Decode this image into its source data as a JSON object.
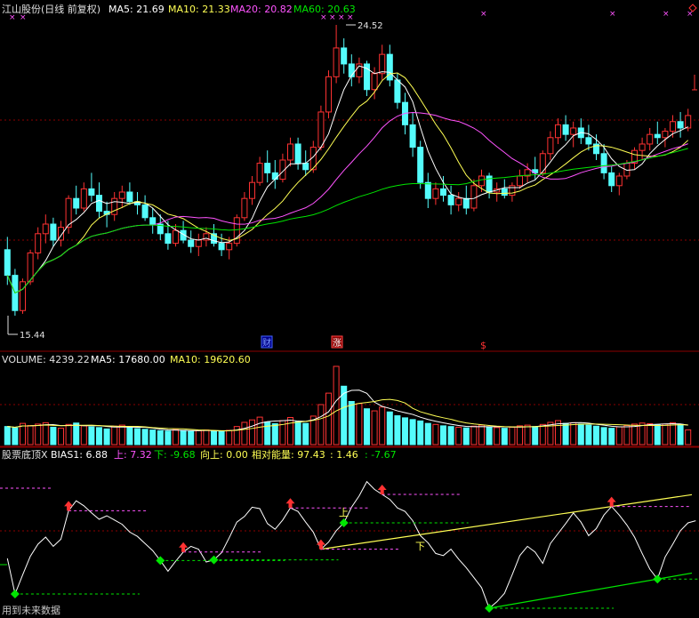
{
  "header": {
    "stock": "江山股份(日线 前复权)",
    "ma5": "MA5: 21.69",
    "ma10": "MA10: 21.33",
    "ma20": "MA20: 20.82",
    "ma60": "MA60: 20.63"
  },
  "volume_header": {
    "title": "VOLUME: 4239.22",
    "ma5": "MA5: 17680.00",
    "ma10": "MA10: 19620.60"
  },
  "indicator_header": {
    "title": "股票底顶X",
    "bias": "BIAS1: 6.88",
    "up": "上: 7.32",
    "down": "下: -9.68",
    "upward": "向上: 0.00",
    "energy": "相对能量: 97.43",
    "v1": ": 1.46",
    "v2": ": -7.67"
  },
  "annotations": {
    "high": "24.52",
    "low": "15.44",
    "event_cai": "财",
    "event_zhang": "涨",
    "event_s": "$",
    "up_mark": "上",
    "down_mark": "下",
    "footer": "用到未来数据"
  },
  "colors": {
    "up": "#ff3232",
    "down": "#54fcfc",
    "ma5": "#ffffff",
    "ma10": "#ffff54",
    "ma20": "#ff54ff",
    "ma60": "#00e600",
    "grid": "#8b0000"
  },
  "chart_data": {
    "type": "candlestick",
    "price_range": [
      15.44,
      24.52
    ],
    "ohlc": [
      [
        17.5,
        17.9,
        16.4,
        16.7
      ],
      [
        16.7,
        16.9,
        15.44,
        15.6
      ],
      [
        15.6,
        16.6,
        15.5,
        16.5
      ],
      [
        16.5,
        17.5,
        16.4,
        17.4
      ],
      [
        17.4,
        18.2,
        17.2,
        18.0
      ],
      [
        18.0,
        18.6,
        17.7,
        18.3
      ],
      [
        18.3,
        18.5,
        17.6,
        17.8
      ],
      [
        17.8,
        18.4,
        17.6,
        18.2
      ],
      [
        18.2,
        19.2,
        18.0,
        19.1
      ],
      [
        19.1,
        19.5,
        18.6,
        18.8
      ],
      [
        18.8,
        19.6,
        18.7,
        19.4
      ],
      [
        19.4,
        19.9,
        19.0,
        19.2
      ],
      [
        19.2,
        19.6,
        18.5,
        18.7
      ],
      [
        18.7,
        19.0,
        18.2,
        18.6
      ],
      [
        18.6,
        19.3,
        18.4,
        19.1
      ],
      [
        19.1,
        19.5,
        18.8,
        19.3
      ],
      [
        19.3,
        19.6,
        18.9,
        19.0
      ],
      [
        19.0,
        19.3,
        18.6,
        18.9
      ],
      [
        18.9,
        19.2,
        18.4,
        18.5
      ],
      [
        18.5,
        18.8,
        18.0,
        18.3
      ],
      [
        18.3,
        18.6,
        17.8,
        18.0
      ],
      [
        18.0,
        18.4,
        17.5,
        17.7
      ],
      [
        17.7,
        18.3,
        17.6,
        18.1
      ],
      [
        18.1,
        18.4,
        17.7,
        17.8
      ],
      [
        17.8,
        18.1,
        17.4,
        17.6
      ],
      [
        17.6,
        18.0,
        17.3,
        17.8
      ],
      [
        17.8,
        18.2,
        17.6,
        18.0
      ],
      [
        18.0,
        18.3,
        17.6,
        17.7
      ],
      [
        17.7,
        18.0,
        17.3,
        17.5
      ],
      [
        17.5,
        17.9,
        17.2,
        17.7
      ],
      [
        17.7,
        18.6,
        17.6,
        18.5
      ],
      [
        18.5,
        19.3,
        18.4,
        19.1
      ],
      [
        19.1,
        19.8,
        18.9,
        19.6
      ],
      [
        19.6,
        20.4,
        19.5,
        20.2
      ],
      [
        20.2,
        20.6,
        19.6,
        19.9
      ],
      [
        19.9,
        20.3,
        19.4,
        19.7
      ],
      [
        19.7,
        20.5,
        19.6,
        20.3
      ],
      [
        20.3,
        21.0,
        20.1,
        20.8
      ],
      [
        20.8,
        21.0,
        20.0,
        20.2
      ],
      [
        20.2,
        20.6,
        19.8,
        20.0
      ],
      [
        20.0,
        20.9,
        19.9,
        20.7
      ],
      [
        20.7,
        22.0,
        20.6,
        21.8
      ],
      [
        21.8,
        23.1,
        21.6,
        22.9
      ],
      [
        22.9,
        24.52,
        22.7,
        23.8
      ],
      [
        23.8,
        24.1,
        23.0,
        23.3
      ],
      [
        23.3,
        23.6,
        22.6,
        22.9
      ],
      [
        22.9,
        23.5,
        22.7,
        23.3
      ],
      [
        23.3,
        23.4,
        22.3,
        22.5
      ],
      [
        22.5,
        23.2,
        22.2,
        23.0
      ],
      [
        23.0,
        23.9,
        22.8,
        23.6
      ],
      [
        23.6,
        23.9,
        22.6,
        22.8
      ],
      [
        22.8,
        23.0,
        21.9,
        22.1
      ],
      [
        22.1,
        22.4,
        21.1,
        21.4
      ],
      [
        21.4,
        21.8,
        20.4,
        20.7
      ],
      [
        20.7,
        20.9,
        19.4,
        19.6
      ],
      [
        19.6,
        19.9,
        18.8,
        19.1
      ],
      [
        19.1,
        19.6,
        18.9,
        19.4
      ],
      [
        19.4,
        19.8,
        19.0,
        19.2
      ],
      [
        19.2,
        19.5,
        18.6,
        18.9
      ],
      [
        18.9,
        19.3,
        18.7,
        19.1
      ],
      [
        19.1,
        19.5,
        18.6,
        18.8
      ],
      [
        18.8,
        19.7,
        18.7,
        19.5
      ],
      [
        19.5,
        20.0,
        19.3,
        19.8
      ],
      [
        19.8,
        19.9,
        19.1,
        19.3
      ],
      [
        19.3,
        19.6,
        19.0,
        19.4
      ],
      [
        19.4,
        19.7,
        19.1,
        19.2
      ],
      [
        19.2,
        19.6,
        19.0,
        19.5
      ],
      [
        19.5,
        20.0,
        19.4,
        19.8
      ],
      [
        19.8,
        20.2,
        19.6,
        20.0
      ],
      [
        20.0,
        20.4,
        19.7,
        19.9
      ],
      [
        19.9,
        20.6,
        19.8,
        20.5
      ],
      [
        20.5,
        21.2,
        20.3,
        21.0
      ],
      [
        21.0,
        21.6,
        20.8,
        21.4
      ],
      [
        21.4,
        21.7,
        20.9,
        21.1
      ],
      [
        21.1,
        21.5,
        20.7,
        21.3
      ],
      [
        21.3,
        21.6,
        20.8,
        21.0
      ],
      [
        21.0,
        21.4,
        20.6,
        20.8
      ],
      [
        20.8,
        21.1,
        20.3,
        20.5
      ],
      [
        20.5,
        20.8,
        19.7,
        19.9
      ],
      [
        19.9,
        20.1,
        19.3,
        19.5
      ],
      [
        19.5,
        19.9,
        19.2,
        19.8
      ],
      [
        19.8,
        20.3,
        19.7,
        20.2
      ],
      [
        20.2,
        20.7,
        20.0,
        20.6
      ],
      [
        20.6,
        21.0,
        20.3,
        20.8
      ],
      [
        20.8,
        21.3,
        20.6,
        21.1
      ],
      [
        21.1,
        21.5,
        20.8,
        21.0
      ],
      [
        21.0,
        21.3,
        20.7,
        21.2
      ],
      [
        21.2,
        21.7,
        21.0,
        21.5
      ],
      [
        21.5,
        21.8,
        21.0,
        21.3
      ],
      [
        21.3,
        21.9,
        21.2,
        21.69
      ]
    ],
    "volume": [
      5200,
      4800,
      6100,
      5500,
      5900,
      6300,
      5000,
      4700,
      5800,
      6200,
      5400,
      5100,
      4900,
      4500,
      5300,
      5600,
      5000,
      4600,
      4400,
      4200,
      4000,
      3900,
      4300,
      4100,
      3800,
      4000,
      4200,
      3900,
      3700,
      4100,
      5200,
      6400,
      7100,
      7900,
      6500,
      6000,
      6900,
      7800,
      6600,
      6100,
      8200,
      11500,
      14800,
      22500,
      16800,
      12400,
      11800,
      10300,
      9700,
      10800,
      9400,
      8300,
      7700,
      7200,
      6800,
      6100,
      5800,
      5400,
      5200,
      5000,
      4800,
      5300,
      5600,
      5100,
      4900,
      4700,
      5000,
      5400,
      5600,
      5200,
      5800,
      6400,
      6900,
      6100,
      6300,
      5900,
      5600,
      5300,
      4900,
      4700,
      5100,
      5500,
      5900,
      6200,
      6000,
      5700,
      5900,
      6300,
      5800,
      4239.22
    ],
    "ma5_close": [
      21.69
    ],
    "indicator": [
      -4.5,
      -9.5,
      -6.8,
      -4.2,
      -2.5,
      -1.5,
      -2.8,
      -1.8,
      2.2,
      3.6,
      2.9,
      1.9,
      1.0,
      1.5,
      0.9,
      0.3,
      -0.8,
      -1.4,
      -2.4,
      -3.4,
      -4.8,
      -6.3,
      -4.9,
      -3.6,
      -2.8,
      -3.2,
      -5.0,
      -4.7,
      -3.7,
      -1.6,
      0.6,
      1.4,
      2.7,
      2.5,
      0.4,
      -0.4,
      0.9,
      2.6,
      2.1,
      0.6,
      -0.8,
      -3.2,
      -2.2,
      -0.6,
      0.5,
      2.7,
      4.3,
      6.3,
      5.2,
      4.5,
      3.8,
      2.6,
      2.1,
      0.8,
      -1.3,
      -2.3,
      -3.8,
      -4.1,
      -3.2,
      -4.6,
      -5.8,
      -7.2,
      -8.6,
      -11.5,
      -10.6,
      -9.4,
      -6.8,
      -4.1,
      -2.8,
      -3.6,
      -5.2,
      -2.4,
      -1.0,
      0.4,
      1.9,
      0.6,
      -1.3,
      -0.3,
      1.6,
      2.8,
      1.6,
      0.2,
      -1.5,
      -3.8,
      -6.0,
      -7.4,
      -4.3,
      -2.5,
      -0.6,
      0.5,
      0.8
    ],
    "signals": {
      "bottoms": [
        1,
        20,
        27,
        44,
        63,
        85
      ],
      "tops": [
        8,
        23,
        37,
        41,
        49,
        79
      ]
    },
    "ranges": {
      "bias": [
        -12,
        8
      ]
    }
  }
}
